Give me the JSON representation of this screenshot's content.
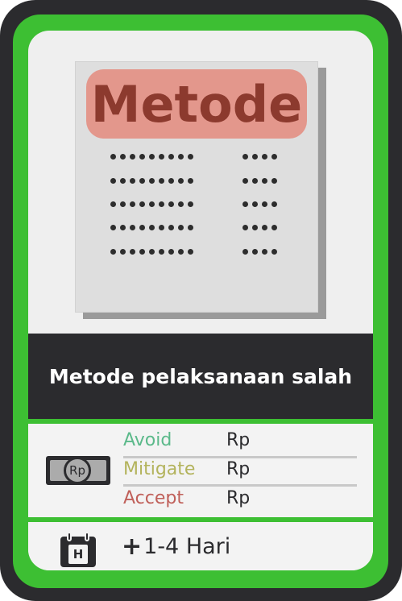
{
  "card": {
    "colors": {
      "outer": "#2b2b2e",
      "border": "#3dbf33",
      "inner": "#efefef"
    }
  },
  "illustration": {
    "badge_text": "Metode",
    "badge_color": "#e3978c",
    "badge_text_color": "#8c3a2e"
  },
  "title": "Metode pelaksanaan salah",
  "risk": {
    "icon": "money-icon",
    "currency_symbol": "Rp",
    "rows": [
      {
        "label": "Avoid",
        "value": "Rp",
        "color": "#5bb98a"
      },
      {
        "label": "Mitigate",
        "value": "Rp",
        "color": "#b3b35c"
      },
      {
        "label": "Accept",
        "value": "Rp",
        "color": "#c0605a"
      }
    ]
  },
  "time": {
    "icon": "calendar-icon",
    "calendar_letter": "H",
    "plus_symbol": "+",
    "duration": "1-4 Hari"
  }
}
